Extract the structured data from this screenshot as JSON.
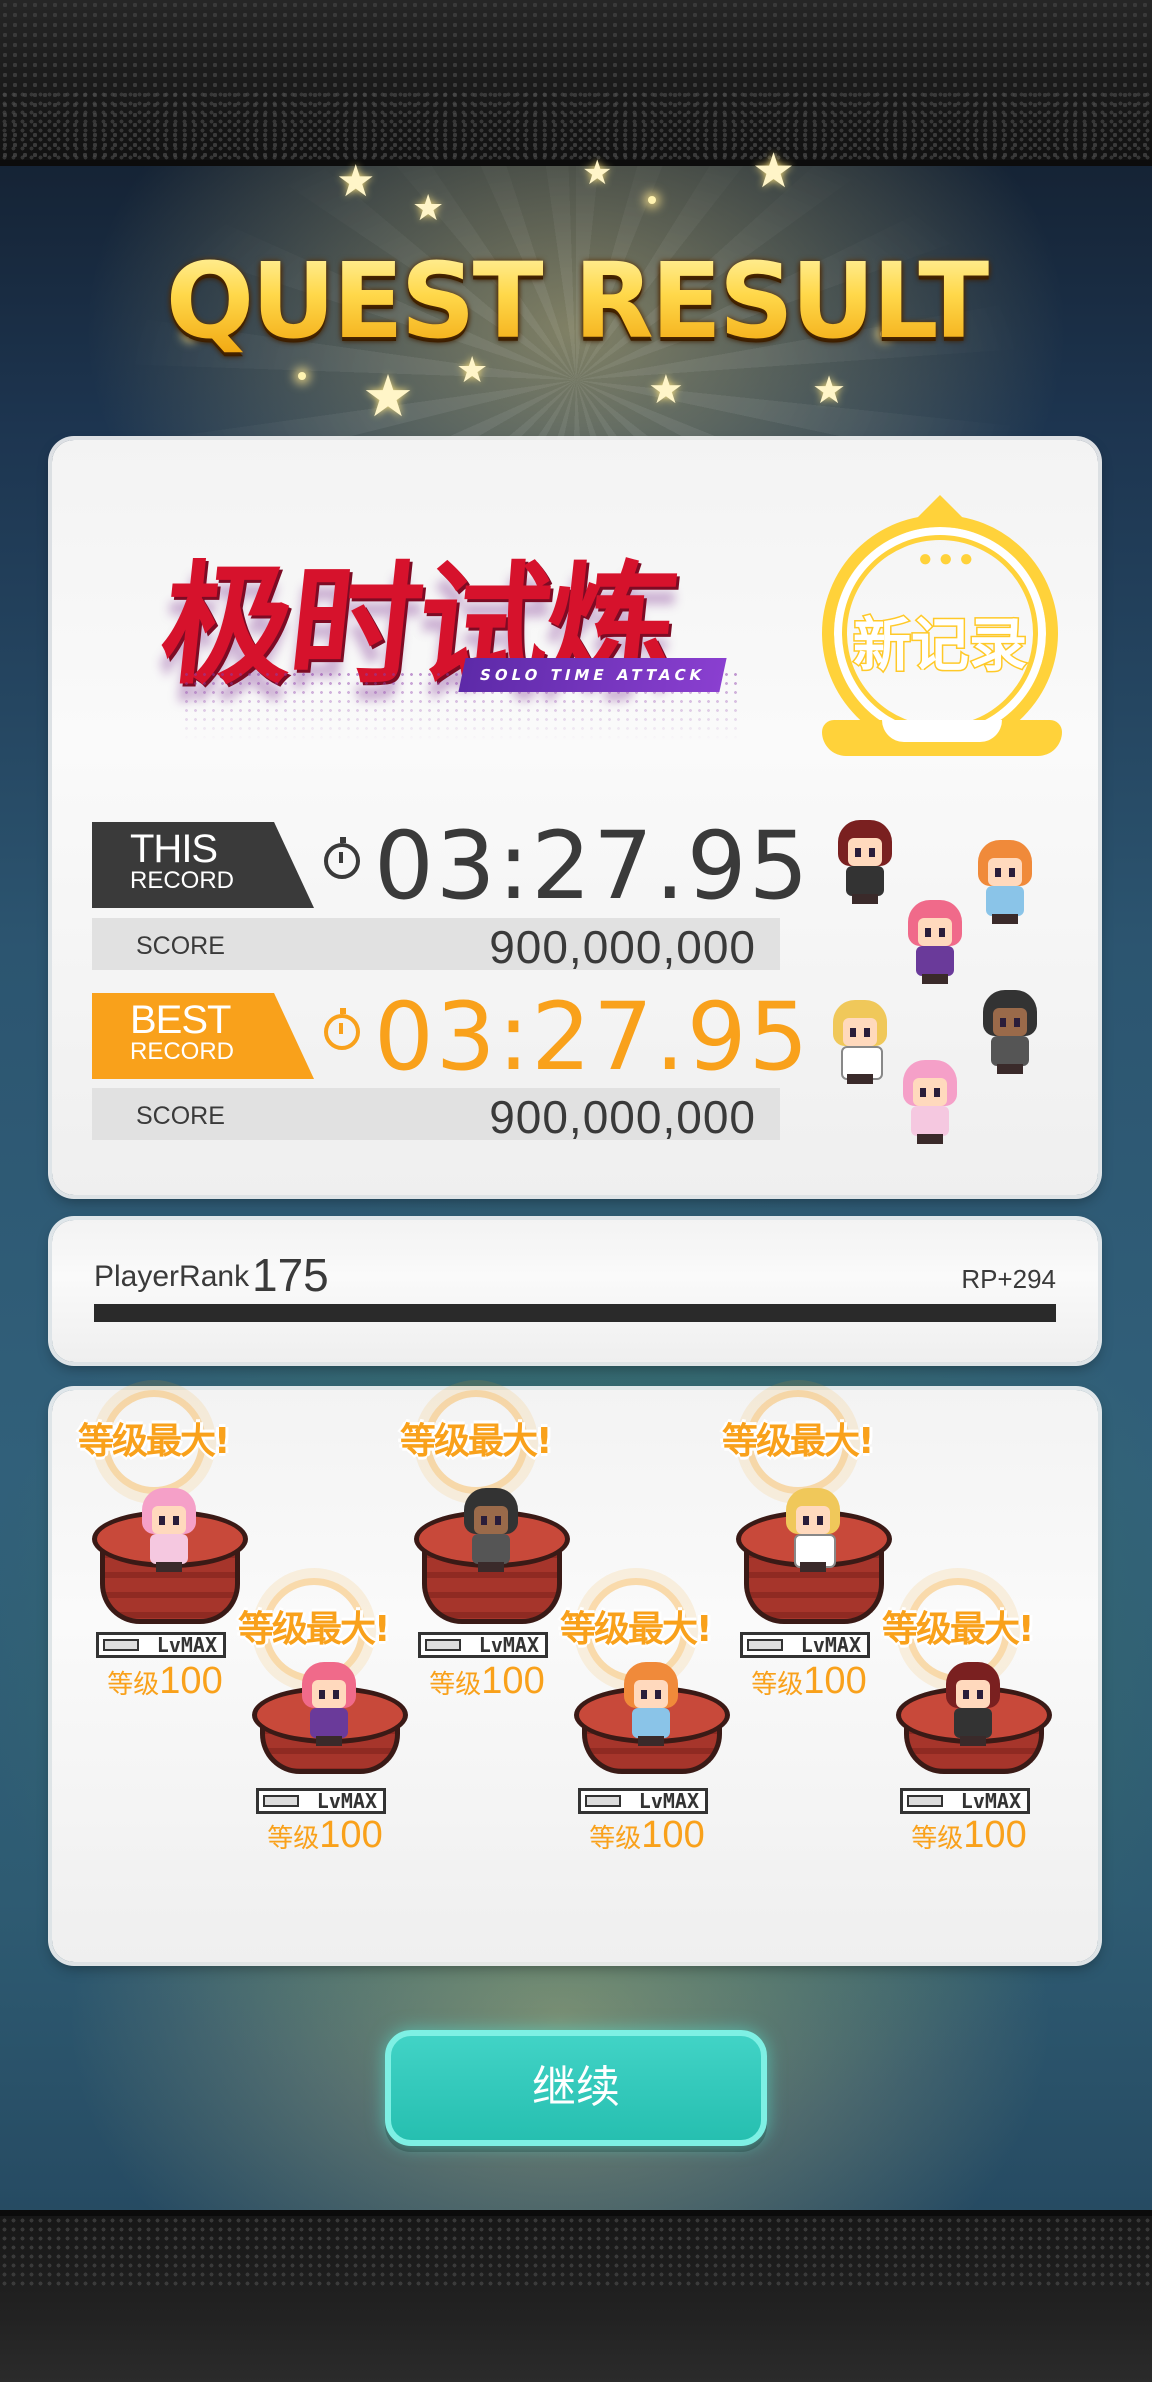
{
  "screen": {
    "title": "QUEST RESULT"
  },
  "logo": {
    "text_cn": "极时试炼",
    "text_en": "SOLO TIME ATTACK"
  },
  "new_record_stamp": "新记录",
  "this_record": {
    "label_top": "THIS",
    "label_bottom": "RECORD",
    "time": "03:27.95",
    "score_label": "SCORE",
    "score": "900,000,000"
  },
  "best_record": {
    "label_top": "BEST",
    "label_bottom": "RECORD",
    "time": "03:27.95",
    "score_label": "SCORE",
    "score": "900,000,000"
  },
  "player_rank": {
    "label": "PlayerRank",
    "value": "175",
    "rp": "RP+294",
    "progress_fraction": 1.0
  },
  "units": [
    {
      "max_label": "等级最大!",
      "badge": "LvMAX",
      "level_label": "等级",
      "level": "100"
    },
    {
      "max_label": "等级最大!",
      "badge": "LvMAX",
      "level_label": "等级",
      "level": "100"
    },
    {
      "max_label": "等级最大!",
      "badge": "LvMAX",
      "level_label": "等级",
      "level": "100"
    },
    {
      "max_label": "等级最大!",
      "badge": "LvMAX",
      "level_label": "等级",
      "level": "100"
    },
    {
      "max_label": "等级最大!",
      "badge": "LvMAX",
      "level_label": "等级",
      "level": "100"
    },
    {
      "max_label": "等级最大!",
      "badge": "LvMAX",
      "level_label": "等级",
      "level": "100"
    }
  ],
  "continue_label": "继续",
  "colors": {
    "accent_orange": "#f9a11b",
    "dark_text": "#3a3a3a",
    "teal_button": "#2fc9bb",
    "gold": "#ffd23a"
  }
}
